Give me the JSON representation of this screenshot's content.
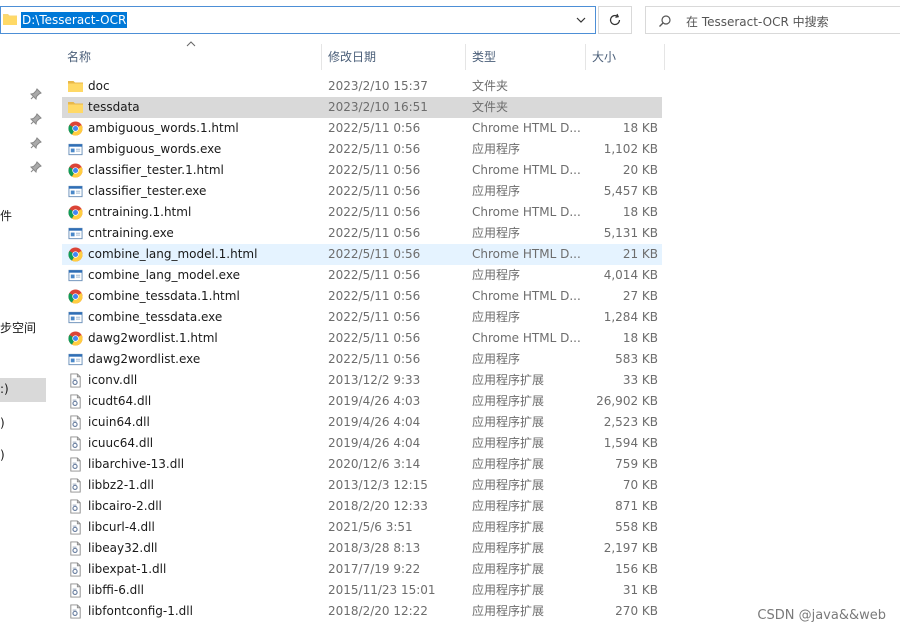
{
  "address": {
    "path": "D:\\Tesseract-OCR"
  },
  "search": {
    "placeholder": "在 Tesseract-OCR 中搜索"
  },
  "nav": {
    "fragments": [
      "件",
      "步空间",
      ":)",
      ")",
      ")"
    ]
  },
  "columns": {
    "name": "名称",
    "date": "修改日期",
    "type": "类型",
    "size": "大小"
  },
  "files": [
    {
      "name": "doc",
      "date": "2023/2/10 15:37",
      "type": "文件夹",
      "size": "",
      "icon": "folder-icon",
      "state": ""
    },
    {
      "name": "tessdata",
      "date": "2023/2/10 16:51",
      "type": "文件夹",
      "size": "",
      "icon": "folder-icon",
      "state": "selected"
    },
    {
      "name": "ambiguous_words.1.html",
      "date": "2022/5/11 0:56",
      "type": "Chrome HTML D...",
      "size": "18 KB",
      "icon": "chrome-icon",
      "state": ""
    },
    {
      "name": "ambiguous_words.exe",
      "date": "2022/5/11 0:56",
      "type": "应用程序",
      "size": "1,102 KB",
      "icon": "exe-icon",
      "state": ""
    },
    {
      "name": "classifier_tester.1.html",
      "date": "2022/5/11 0:56",
      "type": "Chrome HTML D...",
      "size": "20 KB",
      "icon": "chrome-icon",
      "state": ""
    },
    {
      "name": "classifier_tester.exe",
      "date": "2022/5/11 0:56",
      "type": "应用程序",
      "size": "5,457 KB",
      "icon": "exe-icon",
      "state": ""
    },
    {
      "name": "cntraining.1.html",
      "date": "2022/5/11 0:56",
      "type": "Chrome HTML D...",
      "size": "18 KB",
      "icon": "chrome-icon",
      "state": ""
    },
    {
      "name": "cntraining.exe",
      "date": "2022/5/11 0:56",
      "type": "应用程序",
      "size": "5,131 KB",
      "icon": "exe-icon",
      "state": ""
    },
    {
      "name": "combine_lang_model.1.html",
      "date": "2022/5/11 0:56",
      "type": "Chrome HTML D...",
      "size": "21 KB",
      "icon": "chrome-icon",
      "state": "hover"
    },
    {
      "name": "combine_lang_model.exe",
      "date": "2022/5/11 0:56",
      "type": "应用程序",
      "size": "4,014 KB",
      "icon": "exe-icon",
      "state": ""
    },
    {
      "name": "combine_tessdata.1.html",
      "date": "2022/5/11 0:56",
      "type": "Chrome HTML D...",
      "size": "27 KB",
      "icon": "chrome-icon",
      "state": ""
    },
    {
      "name": "combine_tessdata.exe",
      "date": "2022/5/11 0:56",
      "type": "应用程序",
      "size": "1,284 KB",
      "icon": "exe-icon",
      "state": ""
    },
    {
      "name": "dawg2wordlist.1.html",
      "date": "2022/5/11 0:56",
      "type": "Chrome HTML D...",
      "size": "18 KB",
      "icon": "chrome-icon",
      "state": ""
    },
    {
      "name": "dawg2wordlist.exe",
      "date": "2022/5/11 0:56",
      "type": "应用程序",
      "size": "583 KB",
      "icon": "exe-icon",
      "state": ""
    },
    {
      "name": "iconv.dll",
      "date": "2013/12/2 9:33",
      "type": "应用程序扩展",
      "size": "33 KB",
      "icon": "dll-icon",
      "state": ""
    },
    {
      "name": "icudt64.dll",
      "date": "2019/4/26 4:03",
      "type": "应用程序扩展",
      "size": "26,902 KB",
      "icon": "dll-icon",
      "state": ""
    },
    {
      "name": "icuin64.dll",
      "date": "2019/4/26 4:04",
      "type": "应用程序扩展",
      "size": "2,523 KB",
      "icon": "dll-icon",
      "state": ""
    },
    {
      "name": "icuuc64.dll",
      "date": "2019/4/26 4:04",
      "type": "应用程序扩展",
      "size": "1,594 KB",
      "icon": "dll-icon",
      "state": ""
    },
    {
      "name": "libarchive-13.dll",
      "date": "2020/12/6 3:14",
      "type": "应用程序扩展",
      "size": "759 KB",
      "icon": "dll-icon",
      "state": ""
    },
    {
      "name": "libbz2-1.dll",
      "date": "2013/12/3 12:15",
      "type": "应用程序扩展",
      "size": "70 KB",
      "icon": "dll-icon",
      "state": ""
    },
    {
      "name": "libcairo-2.dll",
      "date": "2018/2/20 12:33",
      "type": "应用程序扩展",
      "size": "871 KB",
      "icon": "dll-icon",
      "state": ""
    },
    {
      "name": "libcurl-4.dll",
      "date": "2021/5/6 3:51",
      "type": "应用程序扩展",
      "size": "558 KB",
      "icon": "dll-icon",
      "state": ""
    },
    {
      "name": "libeay32.dll",
      "date": "2018/3/28 8:13",
      "type": "应用程序扩展",
      "size": "2,197 KB",
      "icon": "dll-icon",
      "state": ""
    },
    {
      "name": "libexpat-1.dll",
      "date": "2017/7/19 9:22",
      "type": "应用程序扩展",
      "size": "156 KB",
      "icon": "dll-icon",
      "state": ""
    },
    {
      "name": "libffi-6.dll",
      "date": "2015/11/23 15:01",
      "type": "应用程序扩展",
      "size": "31 KB",
      "icon": "dll-icon",
      "state": ""
    },
    {
      "name": "libfontconfig-1.dll",
      "date": "2018/2/20 12:22",
      "type": "应用程序扩展",
      "size": "270 KB",
      "icon": "dll-icon",
      "state": ""
    }
  ],
  "watermark": "CSDN @java&&web",
  "colors": {
    "accent": "#0078d7",
    "selected_row": "#d9d9d9",
    "hover_row": "#e5f3ff",
    "header_text": "#4c607a",
    "folder": "#f8d775"
  }
}
